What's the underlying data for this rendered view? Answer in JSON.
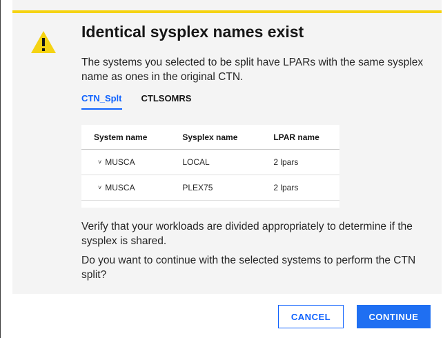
{
  "dialog": {
    "title": "Identical sysplex names exist",
    "lead": "The systems you selected to be split have LPARs with the same sysplex name as ones in the original CTN.",
    "tabs": [
      {
        "label": "CTN_Splt",
        "active": true
      },
      {
        "label": "CTLSOMRS",
        "active": false
      }
    ],
    "table": {
      "headers": [
        "System name",
        "Sysplex name",
        "LPAR name"
      ],
      "rows": [
        {
          "chevron": "˅",
          "system": "MUSCA",
          "sysplex": "LOCAL",
          "lpar": "2 lpars"
        },
        {
          "chevron": "˅",
          "system": "MUSCA",
          "sysplex": "PLEX75",
          "lpar": "2 lpars"
        }
      ]
    },
    "verify_text": "Verify that your workloads are divided appropriately to determine if the sysplex is shared.",
    "question_text": "Do you want to continue with the selected systems to perform the CTN split?",
    "buttons": {
      "cancel": "CANCEL",
      "continue": "CONTINUE"
    }
  },
  "icons": {
    "warning": "warning-icon",
    "expand": "chevron-down-icon"
  },
  "colors": {
    "warning_bar": "#f5d313",
    "primary": "#0f62fe",
    "modal_bg": "#f4f4f4"
  }
}
